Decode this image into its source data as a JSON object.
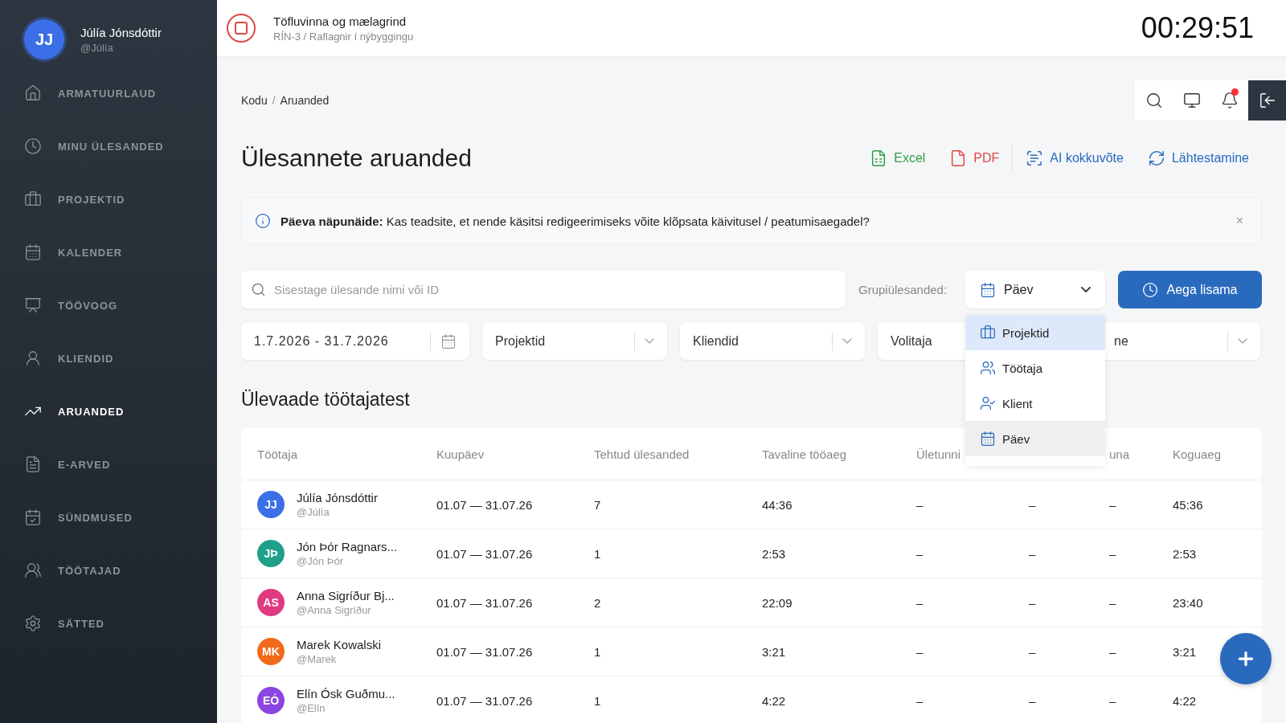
{
  "user": {
    "initials": "JJ",
    "name": "Júlía Jónsdóttir",
    "handle": "@Júlía"
  },
  "nav": [
    {
      "label": "ARMATUURLAUD",
      "selected": false
    },
    {
      "label": "MINU ÜLESANDED",
      "selected": false
    },
    {
      "label": "PROJEKTID",
      "selected": false
    },
    {
      "label": "KALENDER",
      "selected": false
    },
    {
      "label": "TÖÖVOOG",
      "selected": false
    },
    {
      "label": "KLIENDID",
      "selected": false
    },
    {
      "label": "ARUANDED",
      "selected": true
    },
    {
      "label": "E-ARVED",
      "selected": false
    },
    {
      "label": "SÜNDMUSED",
      "selected": false
    },
    {
      "label": "TÖÖTAJAD",
      "selected": false
    },
    {
      "label": "SÄTTED",
      "selected": false
    }
  ],
  "running_task": {
    "title": "Töfluvinna og mælagrind",
    "subtitle": "RÍN-3 / Raflagnir í nýbyggingu"
  },
  "timer": "00:29:51",
  "breadcrumb": {
    "items": [
      "Kodu",
      "Aruanded"
    ],
    "separator": "/"
  },
  "notifications": {
    "unread": true
  },
  "page_title": "Ülesannete aruanded",
  "actions": [
    {
      "label": "Excel",
      "kind": "excel"
    },
    {
      "label": "PDF",
      "kind": "pdf"
    },
    {
      "label": "AI kokkuvõte",
      "kind": "ai"
    },
    {
      "label": "Lähtestamine",
      "kind": "reset"
    }
  ],
  "tip": {
    "text": "**Päeva näpunäide:** Kas teadsite, et nende käsitsi redigeerimiseks võite klõpsata käivitusel / peatumisaegadel?",
    "close": "×"
  },
  "search": {
    "placeholder": "Sisestage ülesande nimi või ID"
  },
  "group_by": {
    "label": "Grupiülesanded:",
    "value": "Päev",
    "expanded": true,
    "options": [
      {
        "label": "Projektid",
        "kind": "project",
        "highlighted": true,
        "selected": false
      },
      {
        "label": "Töötaja",
        "kind": "employee",
        "highlighted": false,
        "selected": false
      },
      {
        "label": "Klient",
        "kind": "client",
        "highlighted": false,
        "selected": false
      },
      {
        "label": "Päev",
        "kind": "day",
        "highlighted": false,
        "selected": true
      }
    ]
  },
  "add_time_button": "Aega lisama",
  "filters": [
    {
      "kind": "date",
      "value": "1.7.2026 - 31.7.2026"
    },
    {
      "kind": "select",
      "value": "Projektid"
    },
    {
      "kind": "select",
      "value": "Kliendid"
    },
    {
      "kind": "select",
      "value": "Volitaja"
    },
    {
      "kind": "select",
      "value": "ne"
    }
  ],
  "section_title": "Ülevaade töötajatest",
  "table": {
    "columns": [
      {
        "label": "Töötaja"
      },
      {
        "label": "Kuupäev"
      },
      {
        "label": "Tehtud ülesanded"
      },
      {
        "label": "Tavaline tööaeg"
      },
      {
        "label": "Ületunni"
      },
      {},
      {
        "label": "una"
      },
      {
        "label": "Koguaeg"
      }
    ],
    "rows": [
      {
        "cells": [
          {
            "initials": "JJ",
            "color": "#3b6fe8",
            "name": "Júlía Jónsdóttir",
            "handle": "@Júlía"
          },
          "01.07 — 31.07.26",
          "7",
          "44:36",
          "–",
          "–",
          "–",
          "45:36"
        ]
      },
      {
        "cells": [
          {
            "initials": "JÞ",
            "color": "#1fa08a",
            "name": "Jón Þór Ragnars...",
            "handle": "@Jón Þór"
          },
          "01.07 — 31.07.26",
          "1",
          "2:53",
          "–",
          "–",
          "–",
          "2:53"
        ]
      },
      {
        "cells": [
          {
            "initials": "AS",
            "color": "#e03a82",
            "name": "Anna Sigríður Bj...",
            "handle": "@Anna Sigríður"
          },
          "01.07 — 31.07.26",
          "2",
          "22:09",
          "–",
          "–",
          "–",
          "23:40"
        ]
      },
      {
        "cells": [
          {
            "initials": "MK",
            "color": "#f26b1d",
            "name": "Marek Kowalski",
            "handle": "@Marek"
          },
          "01.07 — 31.07.26",
          "1",
          "3:21",
          "–",
          "–",
          "–",
          "3:21"
        ]
      },
      {
        "cells": [
          {
            "initials": "EÓ",
            "color": "#8b45e0",
            "name": "Elín Ósk Guðmu...",
            "handle": "@Elín"
          },
          "01.07 — 31.07.26",
          "1",
          "4:22",
          "–",
          "–",
          "–",
          "4:22"
        ]
      }
    ]
  }
}
